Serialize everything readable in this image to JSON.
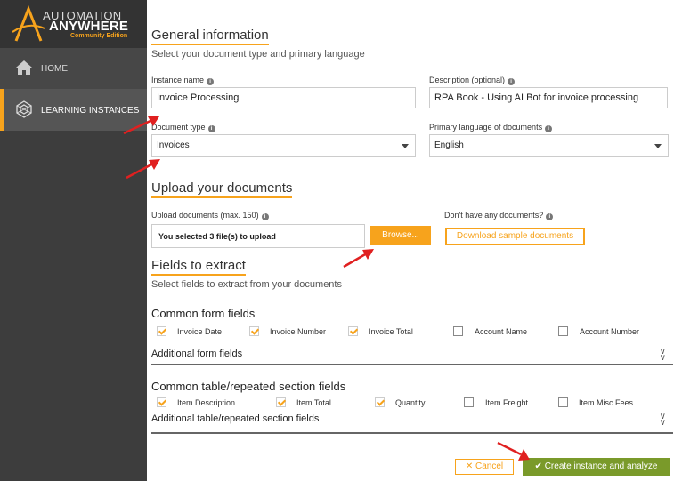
{
  "sidebar": {
    "logo_line1": "AUTOMATION",
    "logo_line2": "ANYWHERE",
    "logo_line3": "Community Edition",
    "items": [
      {
        "label": "HOME",
        "icon": "home-icon"
      },
      {
        "label": "LEARNING INSTANCES",
        "icon": "learning-instances-icon",
        "active": true
      }
    ]
  },
  "general": {
    "title": "General information",
    "subtitle": "Select your document type and primary language",
    "instance_name_label": "Instance name",
    "instance_name_value": "Invoice Processing",
    "description_label": "Description (optional)",
    "description_value": "RPA Book - Using AI Bot for invoice processing",
    "doc_type_label": "Document type",
    "doc_type_value": "Invoices",
    "language_label": "Primary language of documents",
    "language_value": "English"
  },
  "upload": {
    "title": "Upload your documents",
    "upload_label": "Upload documents (max. 150)",
    "file_status": "You selected 3 file(s) to upload",
    "browse_label": "Browse...",
    "no_docs_label": "Don't have any documents?",
    "sample_label": "Download sample documents"
  },
  "fields": {
    "title": "Fields to extract",
    "subtitle": "Select fields to extract from your documents",
    "common_form_title": "Common form fields",
    "form_fields": [
      {
        "label": "Invoice Date",
        "checked": true
      },
      {
        "label": "Invoice Number",
        "checked": true
      },
      {
        "label": "Invoice Total",
        "checked": true
      },
      {
        "label": "Account Name",
        "checked": false
      },
      {
        "label": "Account Number",
        "checked": false
      }
    ],
    "additional_form_label": "Additional form fields",
    "common_table_title": "Common table/repeated section fields",
    "table_fields": [
      {
        "label": "Item Description",
        "checked": true
      },
      {
        "label": "Item Total",
        "checked": true
      },
      {
        "label": "Quantity",
        "checked": true
      },
      {
        "label": "Item Freight",
        "checked": false
      },
      {
        "label": "Item Misc Fees",
        "checked": false
      }
    ],
    "additional_table_label": "Additional table/repeated section fields"
  },
  "actions": {
    "cancel_label": "Cancel",
    "create_label": "Create instance and analyze"
  },
  "colors": {
    "accent": "#f7a31c",
    "sidebar": "#3d3d3d",
    "create_button": "#7a9a2a",
    "annotation_arrow": "#e02020"
  }
}
